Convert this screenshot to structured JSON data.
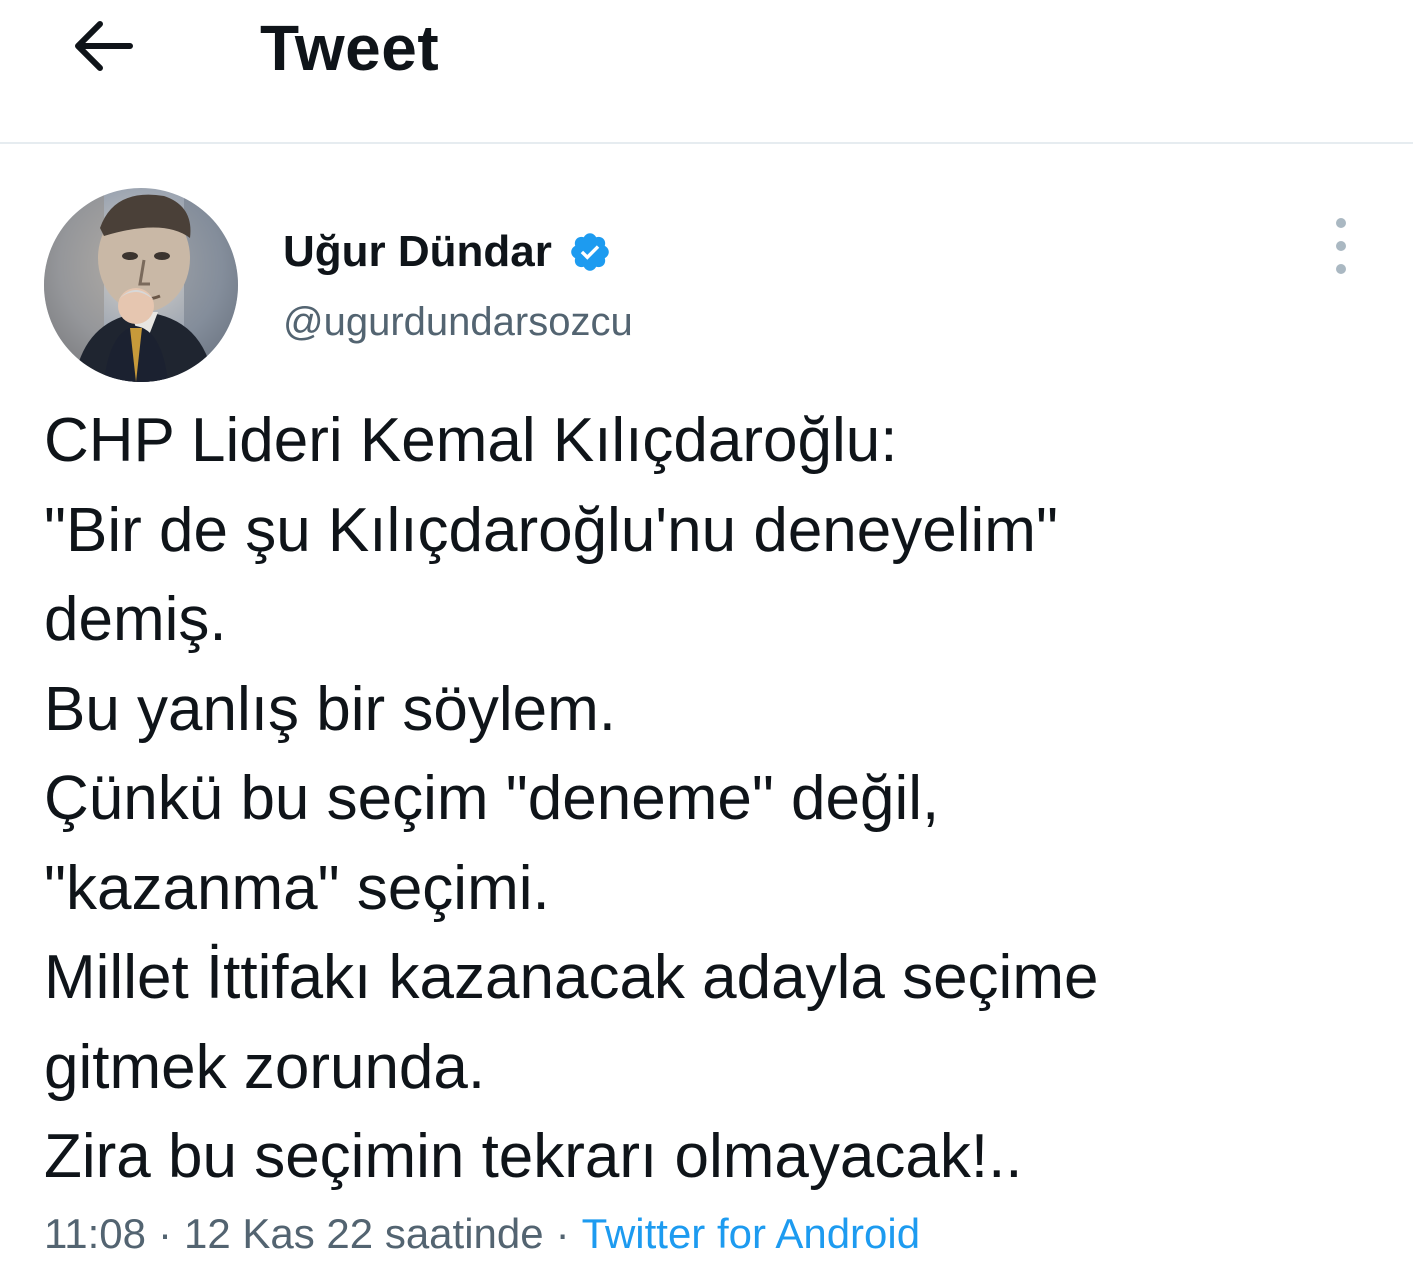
{
  "header": {
    "back_icon": "arrow-left-icon",
    "title": "Tweet"
  },
  "tweet": {
    "author": {
      "display_name": "Uğur Dündar",
      "handle": "@ugurdundarsozcu",
      "verified": true,
      "verified_icon": "verified-badge-icon",
      "verified_color": "#1d9bf0",
      "avatar": "profile-avatar"
    },
    "more_icon": "more-vertical-icon",
    "text_lines": [
      "CHP Lideri Kemal Kılıçdaroğlu:",
      "\"Bir de şu Kılıçdaroğlu'nu deneyelim\"",
      "demiş.",
      "Bu yanlış bir söylem.",
      "Çünkü bu seçim \"deneme\" değil,",
      "\"kazanma\" seçimi.",
      "Millet İttifakı kazanacak adayla seçime",
      "gitmek zorunda.",
      "Zira bu seçimin tekrarı olmayacak!.."
    ],
    "meta": {
      "time": "11:08",
      "separator": "·",
      "date": "12 Kas 22 saatinde",
      "source": "Twitter for Android",
      "source_color": "#1d9bf0"
    }
  }
}
